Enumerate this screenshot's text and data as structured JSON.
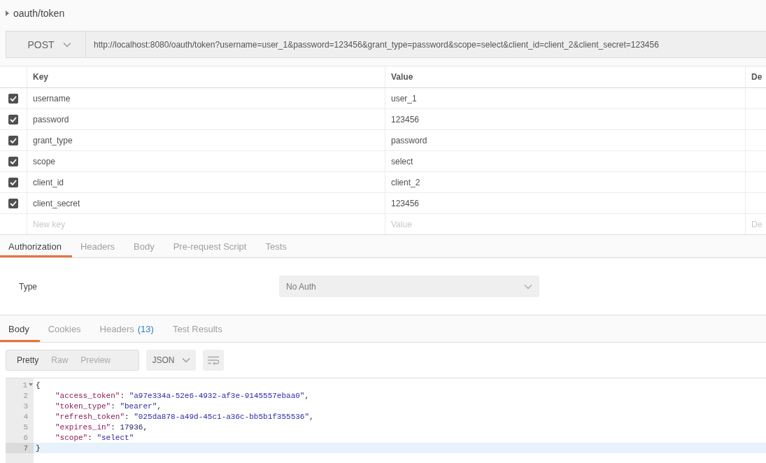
{
  "request": {
    "name": "oauth/token",
    "method": "POST",
    "url": "http://localhost:8080/oauth/token?username=user_1&password=123456&grant_type=password&scope=select&client_id=client_2&client_secret=123456"
  },
  "params": {
    "columns": [
      "Key",
      "Value",
      "De"
    ],
    "rows": [
      {
        "checked": true,
        "key": "username",
        "value": "user_1"
      },
      {
        "checked": true,
        "key": "password",
        "value": "123456"
      },
      {
        "checked": true,
        "key": "grant_type",
        "value": "password"
      },
      {
        "checked": true,
        "key": "scope",
        "value": "select"
      },
      {
        "checked": true,
        "key": "client_id",
        "value": "client_2"
      },
      {
        "checked": true,
        "key": "client_secret",
        "value": "123456"
      }
    ],
    "new_row": {
      "key_placeholder": "New key",
      "value_placeholder": "Value",
      "column_3_placeholder": "De"
    }
  },
  "request_tabs": [
    {
      "label": "Authorization",
      "selected": true
    },
    {
      "label": "Headers",
      "selected": false
    },
    {
      "label": "Body",
      "selected": false
    },
    {
      "label": "Pre-request Script",
      "selected": false
    },
    {
      "label": "Tests",
      "selected": false
    }
  ],
  "auth": {
    "label": "Type",
    "value": "No Auth"
  },
  "response_tabs": [
    {
      "label": "Body",
      "selected": true
    },
    {
      "label": "Cookies",
      "selected": false
    },
    {
      "label": "Headers",
      "count": "(13)",
      "selected": false
    },
    {
      "label": "Test Results",
      "selected": false
    }
  ],
  "view_modes": [
    {
      "label": "Pretty",
      "selected": true
    },
    {
      "label": "Raw",
      "selected": false
    },
    {
      "label": "Preview",
      "selected": false
    }
  ],
  "format": "JSON",
  "code": [
    {
      "number": "1",
      "foldable": true,
      "indented": false,
      "active": false,
      "tokens": [
        {
          "kind": "punct",
          "text": "{"
        }
      ]
    },
    {
      "number": "2",
      "foldable": false,
      "indented": true,
      "active": false,
      "tokens": [
        {
          "kind": "key",
          "text": "\"access_token\""
        },
        {
          "kind": "punct",
          "text": ": "
        },
        {
          "kind": "string",
          "text": "\"a97e334a-52e6-4932-af3e-9145557ebaa0\""
        },
        {
          "kind": "punct",
          "text": ","
        }
      ]
    },
    {
      "number": "3",
      "foldable": false,
      "indented": true,
      "active": false,
      "tokens": [
        {
          "kind": "key",
          "text": "\"token_type\""
        },
        {
          "kind": "punct",
          "text": ": "
        },
        {
          "kind": "string",
          "text": "\"bearer\""
        },
        {
          "kind": "punct",
          "text": ","
        }
      ]
    },
    {
      "number": "4",
      "foldable": false,
      "indented": true,
      "active": false,
      "tokens": [
        {
          "kind": "key",
          "text": "\"refresh_token\""
        },
        {
          "kind": "punct",
          "text": ": "
        },
        {
          "kind": "string",
          "text": "\"025da878-a49d-45c1-a36c-bb5b1f355536\""
        },
        {
          "kind": "punct",
          "text": ","
        }
      ]
    },
    {
      "number": "5",
      "foldable": false,
      "indented": true,
      "active": false,
      "tokens": [
        {
          "kind": "key",
          "text": "\"expires_in\""
        },
        {
          "kind": "punct",
          "text": ": "
        },
        {
          "kind": "number",
          "text": "17936"
        },
        {
          "kind": "punct",
          "text": ","
        }
      ]
    },
    {
      "number": "6",
      "foldable": false,
      "indented": true,
      "active": false,
      "tokens": [
        {
          "kind": "key",
          "text": "\"scope\""
        },
        {
          "kind": "punct",
          "text": ": "
        },
        {
          "kind": "string",
          "text": "\"select\""
        }
      ]
    },
    {
      "number": "7",
      "foldable": false,
      "indented": false,
      "active": true,
      "tokens": [
        {
          "kind": "punct",
          "text": "}"
        }
      ]
    }
  ]
}
